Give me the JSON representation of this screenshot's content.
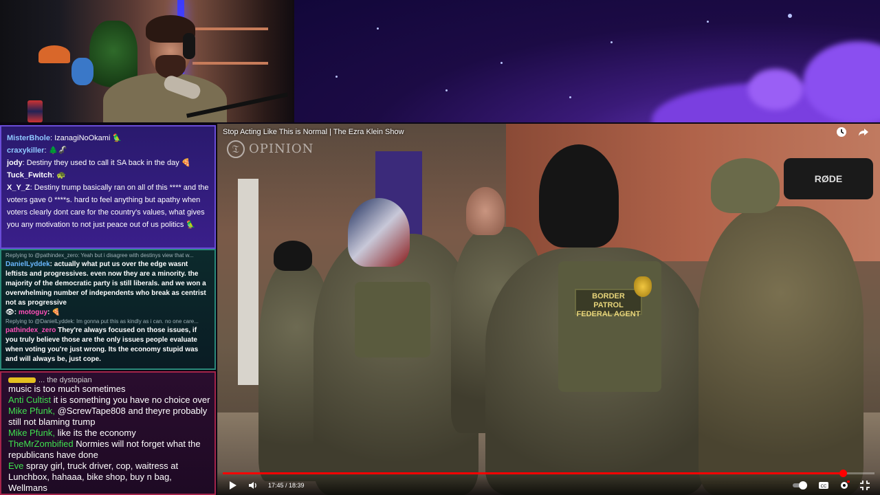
{
  "video": {
    "title": "Stop Acting Like This is Normal | The Ezra Klein Show",
    "watermark": "OPINION",
    "time_display": "17:45 / 18:39",
    "progress_fraction": 0.952,
    "patch_line1": "BORDER PATROL",
    "patch_line2": "FEDERAL AGENT",
    "camera_brand": "RØDE"
  },
  "chat1": [
    {
      "user": "MisterBhole",
      "user_color": "#8fc8ff",
      "text": "IzanagiNoOkami"
    },
    {
      "user": "craxykiller",
      "user_color": "#8fc8ff",
      "text": ""
    },
    {
      "user": "jody",
      "user_color": "#ffffff",
      "text": "Destiny they used to call it SA back in the day"
    },
    {
      "user": "Tuck_Fwitch",
      "user_color": "#ffffff",
      "text": ""
    },
    {
      "user": "X_Y_Z",
      "user_color": "#ffffff",
      "text": "Destiny trump basically ran on all of this **** and the voters gave 0 ****s. hard to feel anything but apathy when voters clearly dont care for the country's values, what gives you any motivation to not just peace out of us politics"
    }
  ],
  "chat2": {
    "reply1": "Replying to @pathindex_zero: Yeah but i disagree with destinys view that w...",
    "msg1_user": "DanielLyddek",
    "msg1_text": "actually what put us over the edge wasnt leftists and progressives. even now they are a minority. the majority of the democratic party is still liberals. and we won a overwhelming number of independents who break as centrist not as progressive",
    "msg2_user": "motoguy",
    "reply2": "Replying to @DanielLyddek: Im gonna put this as kindly as i can. no one care...",
    "msg3_user": "pathindex_zero",
    "msg3_text": "They're always focused on those issues, if you truly believe those are the only issues people evaluate when voting you're just wrong. Its the economy stupid was and will always be, just cope."
  },
  "chat3": {
    "cut_line": "... the dystopian",
    "messages": [
      {
        "user": "",
        "text": "music is too much sometimes"
      },
      {
        "user": "Anti Cultist",
        "text": "it is something you have no choice over"
      },
      {
        "user": "Mike Pfunk",
        "text": "@ScrewTape808 and theyre probably still not blaming trump"
      },
      {
        "user": "Mike Pfunk",
        "text": "like its the economy"
      },
      {
        "user": "TheMrZombified",
        "text": "Normies will not forget what the republicans have done"
      },
      {
        "user": "Eve",
        "text": "spray girl, truck driver, cop, waitress at Lunchbox, hahaaa, bike shop, buy n bag, Wellmans"
      }
    ]
  }
}
